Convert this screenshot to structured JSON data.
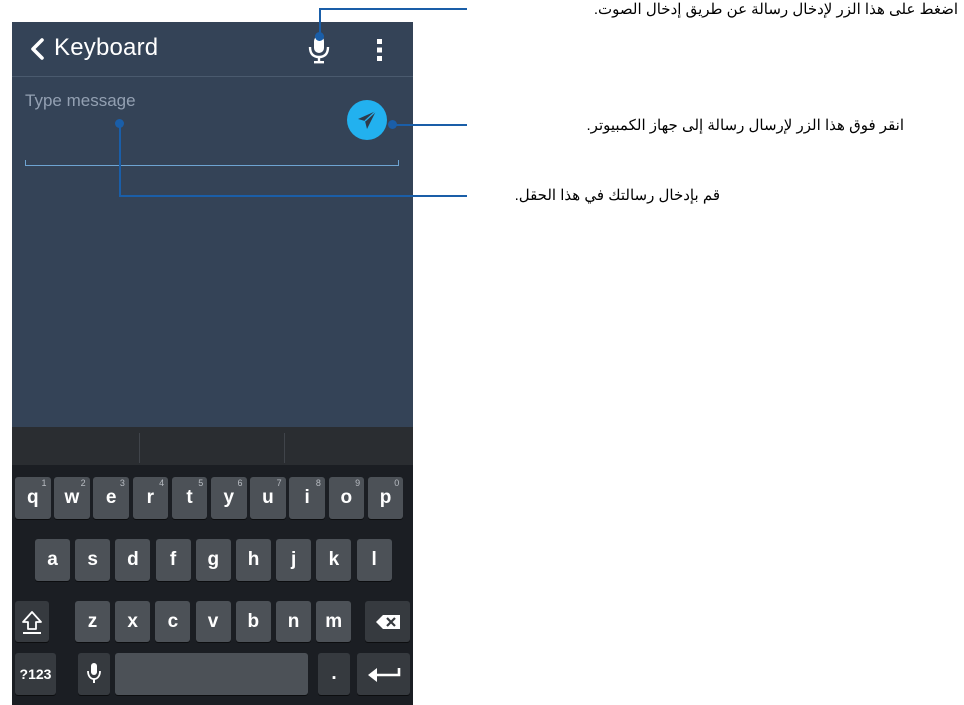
{
  "app_bar": {
    "title": "Keyboard"
  },
  "compose": {
    "placeholder": "Type message"
  },
  "keyboard": {
    "row1": [
      {
        "k": "q",
        "h": "1"
      },
      {
        "k": "w",
        "h": "2"
      },
      {
        "k": "e",
        "h": "3"
      },
      {
        "k": "r",
        "h": "4"
      },
      {
        "k": "t",
        "h": "5"
      },
      {
        "k": "y",
        "h": "6"
      },
      {
        "k": "u",
        "h": "7"
      },
      {
        "k": "i",
        "h": "8"
      },
      {
        "k": "o",
        "h": "9"
      },
      {
        "k": "p",
        "h": "0"
      }
    ],
    "row2": [
      "a",
      "s",
      "d",
      "f",
      "g",
      "h",
      "j",
      "k",
      "l"
    ],
    "row3": [
      "z",
      "x",
      "c",
      "v",
      "b",
      "n",
      "m"
    ],
    "symbols_label": "?123",
    "period_label": "."
  },
  "callouts": {
    "mic": "اضغط على هذا الزر لإدخال رسالة عن طريق إدخال الصوت.",
    "send": "انقر فوق هذا الزر لإرسال رسالة إلى جهاز الكمبيوتر.",
    "field": "قم بإدخال رسالتك في هذا الحقل."
  },
  "colors": {
    "app_bg": "#344357",
    "send_button": "#22b1ef",
    "callout_line": "#1a5ea8",
    "keyboard_bg": "#1b1e23"
  }
}
